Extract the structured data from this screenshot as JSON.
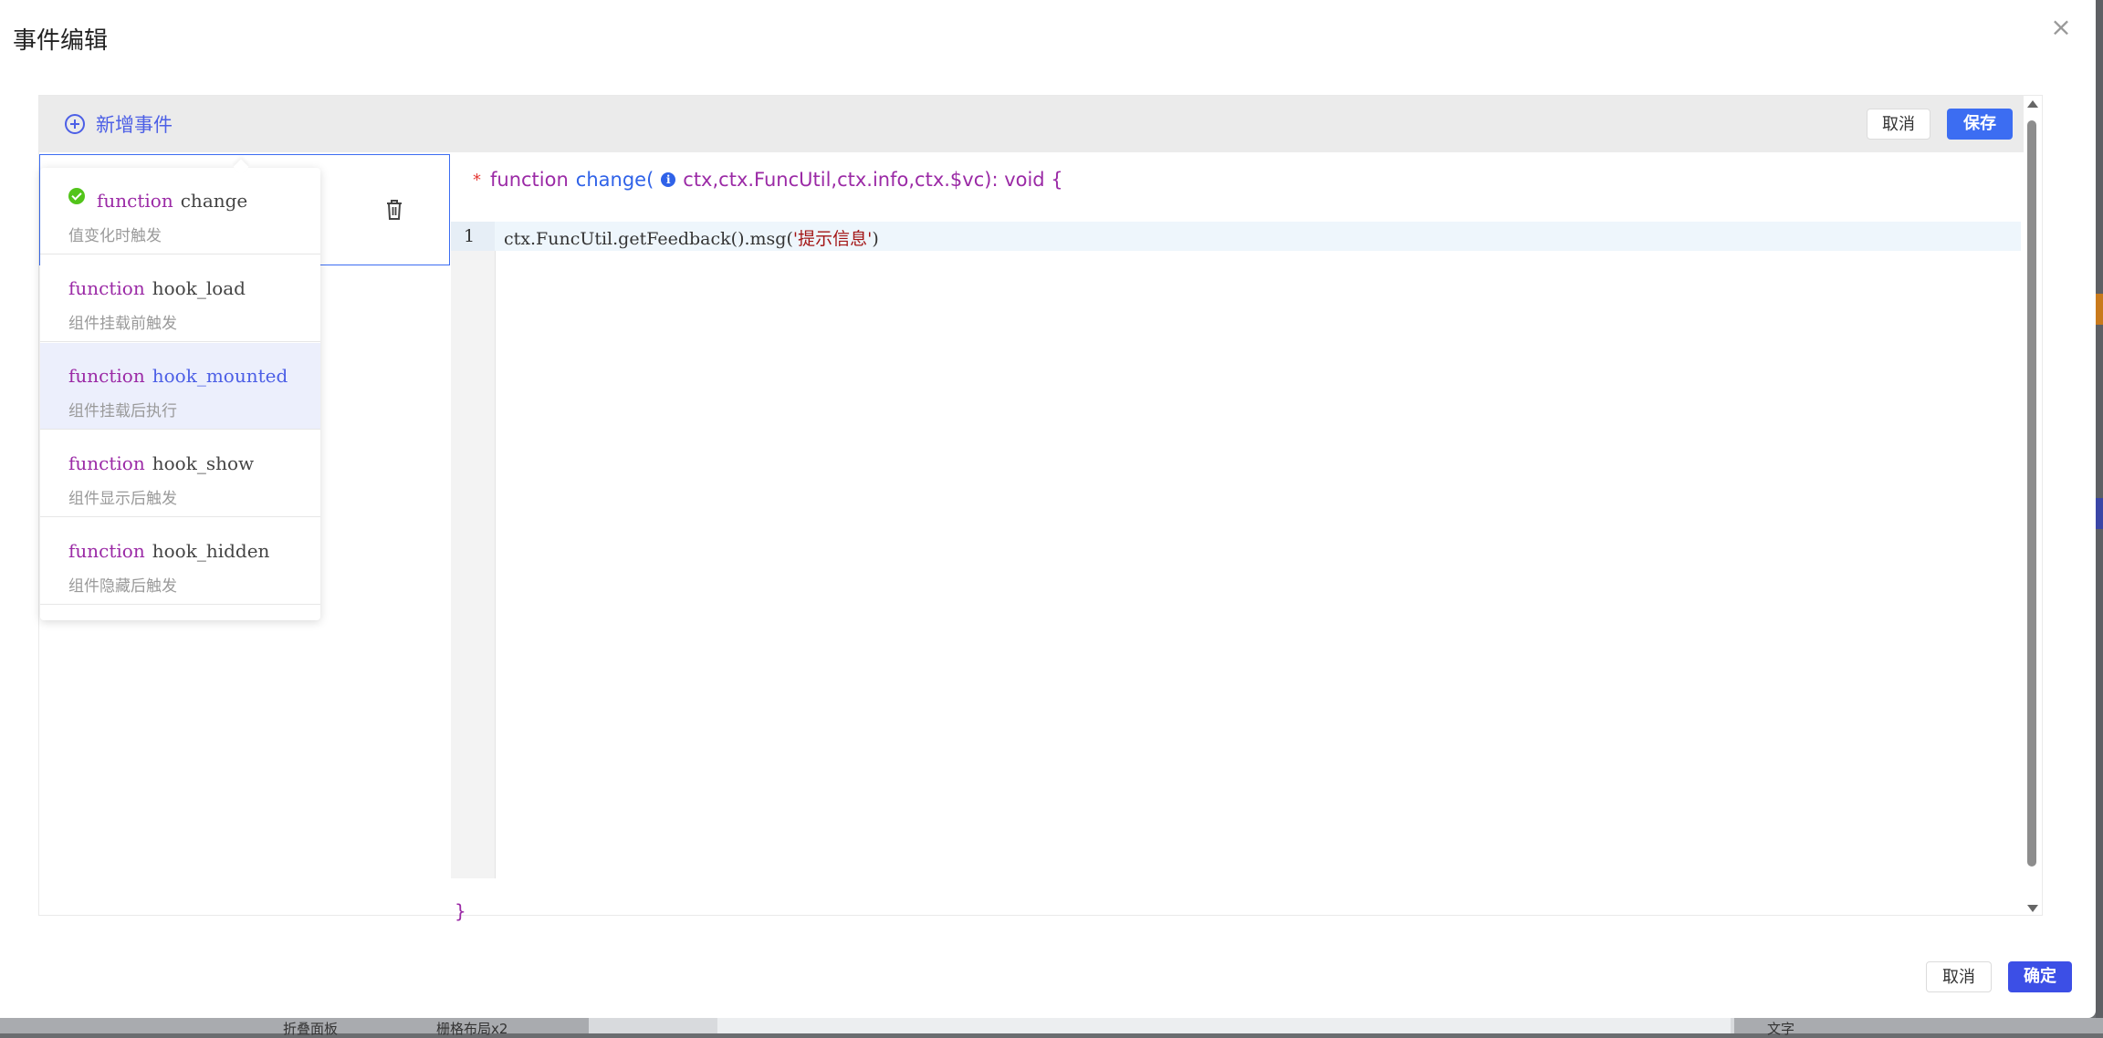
{
  "modal": {
    "title": "事件编辑",
    "close_icon": "×"
  },
  "toolbar": {
    "add_event_label": "新增事件",
    "cancel_label": "取消",
    "save_label": "保存"
  },
  "editor": {
    "signature": {
      "required_mark": "*",
      "keyword": "function",
      "name": "change(",
      "params": "ctx,ctx.FuncUtil,ctx.info,ctx.$vc): void {"
    },
    "lines": [
      {
        "number": "1",
        "code_prefix": "ctx.FuncUtil.getFeedback().msg(",
        "code_string": "'提示信息'",
        "code_suffix": ")"
      }
    ],
    "closing": "}"
  },
  "dropdown": {
    "items": [
      {
        "keyword": "function",
        "name": "change",
        "desc": "值变化时触发",
        "selected": true
      },
      {
        "keyword": "function",
        "name": "hook_load",
        "desc": "组件挂载前触发",
        "selected": false
      },
      {
        "keyword": "function",
        "name": "hook_mounted",
        "desc": "组件挂载后执行",
        "selected": false
      },
      {
        "keyword": "function",
        "name": "hook_show",
        "desc": "组件显示后触发",
        "selected": false
      },
      {
        "keyword": "function",
        "name": "hook_hidden",
        "desc": "组件隐藏后触发",
        "selected": false
      }
    ]
  },
  "footer": {
    "cancel_label": "取消",
    "ok_label": "确定"
  },
  "background": {
    "tab1": "折叠面板",
    "tab2": "栅格布局x2",
    "select": "文字"
  },
  "colors": {
    "primary": "#3c6df2",
    "keyword": "#9b2aa6",
    "success": "#52c41a"
  }
}
